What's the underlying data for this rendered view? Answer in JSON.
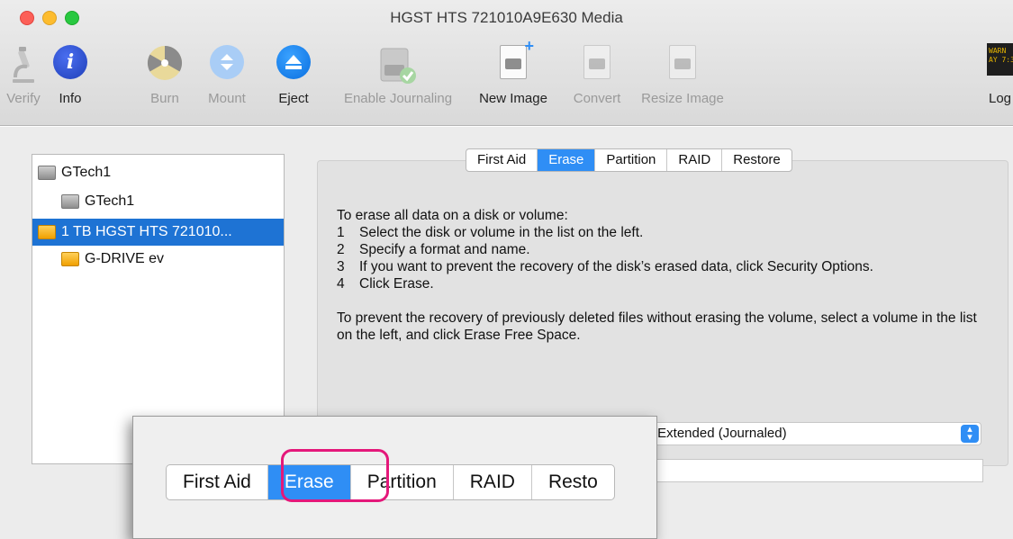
{
  "window": {
    "title": "HGST HTS 721010A9E630 Media"
  },
  "toolbar": {
    "items": [
      {
        "label": "Verify",
        "icon": "microscope-icon",
        "enabled": false
      },
      {
        "label": "Info",
        "icon": "info-icon",
        "enabled": true
      },
      {
        "label": "Burn",
        "icon": "burn-icon",
        "enabled": false
      },
      {
        "label": "Mount",
        "icon": "mount-icon",
        "enabled": false
      },
      {
        "label": "Eject",
        "icon": "eject-icon",
        "enabled": true
      },
      {
        "label": "Enable Journaling",
        "icon": "journaling-icon",
        "enabled": false
      },
      {
        "label": "New Image",
        "icon": "new-image-icon",
        "enabled": true
      },
      {
        "label": "Convert",
        "icon": "convert-icon",
        "enabled": false
      },
      {
        "label": "Resize Image",
        "icon": "resize-image-icon",
        "enabled": false
      }
    ],
    "log": {
      "label": "Log",
      "icon_text": "WARN\nAY 7:3"
    }
  },
  "sidebar": {
    "items": [
      {
        "label": "GTech1",
        "icon": "disk-gray",
        "selected": false
      },
      {
        "label": "GTech1",
        "icon": "volume-gray",
        "selected": false
      },
      {
        "label": "1 TB HGST HTS 721010...",
        "icon": "disk-orange",
        "selected": true
      },
      {
        "label": "G-DRIVE ev",
        "icon": "volume-orange",
        "selected": false
      }
    ]
  },
  "tabs": [
    "First Aid",
    "Erase",
    "Partition",
    "RAID",
    "Restore"
  ],
  "active_tab": "Erase",
  "instructions": {
    "intro": "To erase all data on a disk or volume:",
    "steps": [
      {
        "num": "1",
        "text": "Select the disk or volume in the list on the left."
      },
      {
        "num": "2",
        "text": "Specify a format and name."
      },
      {
        "num": "3",
        "text": "If you want to prevent the recovery of the disk’s erased data, click Security Options."
      },
      {
        "num": "4",
        "text": "Click Erase."
      }
    ],
    "free_space": "To prevent the recovery of previously deleted files without erasing the volume, select a volume in the list on the left, and click Erase Free Space."
  },
  "format": {
    "value": "S Extended (Journaled)"
  },
  "zoom": {
    "tabs": [
      "First Aid",
      "Erase",
      "Partition",
      "RAID",
      "Resto"
    ],
    "active_tab": "Erase",
    "highlight_color": "#e4187a"
  },
  "colors": {
    "accent": "#2f8ef5",
    "selection": "#1e73d4"
  }
}
